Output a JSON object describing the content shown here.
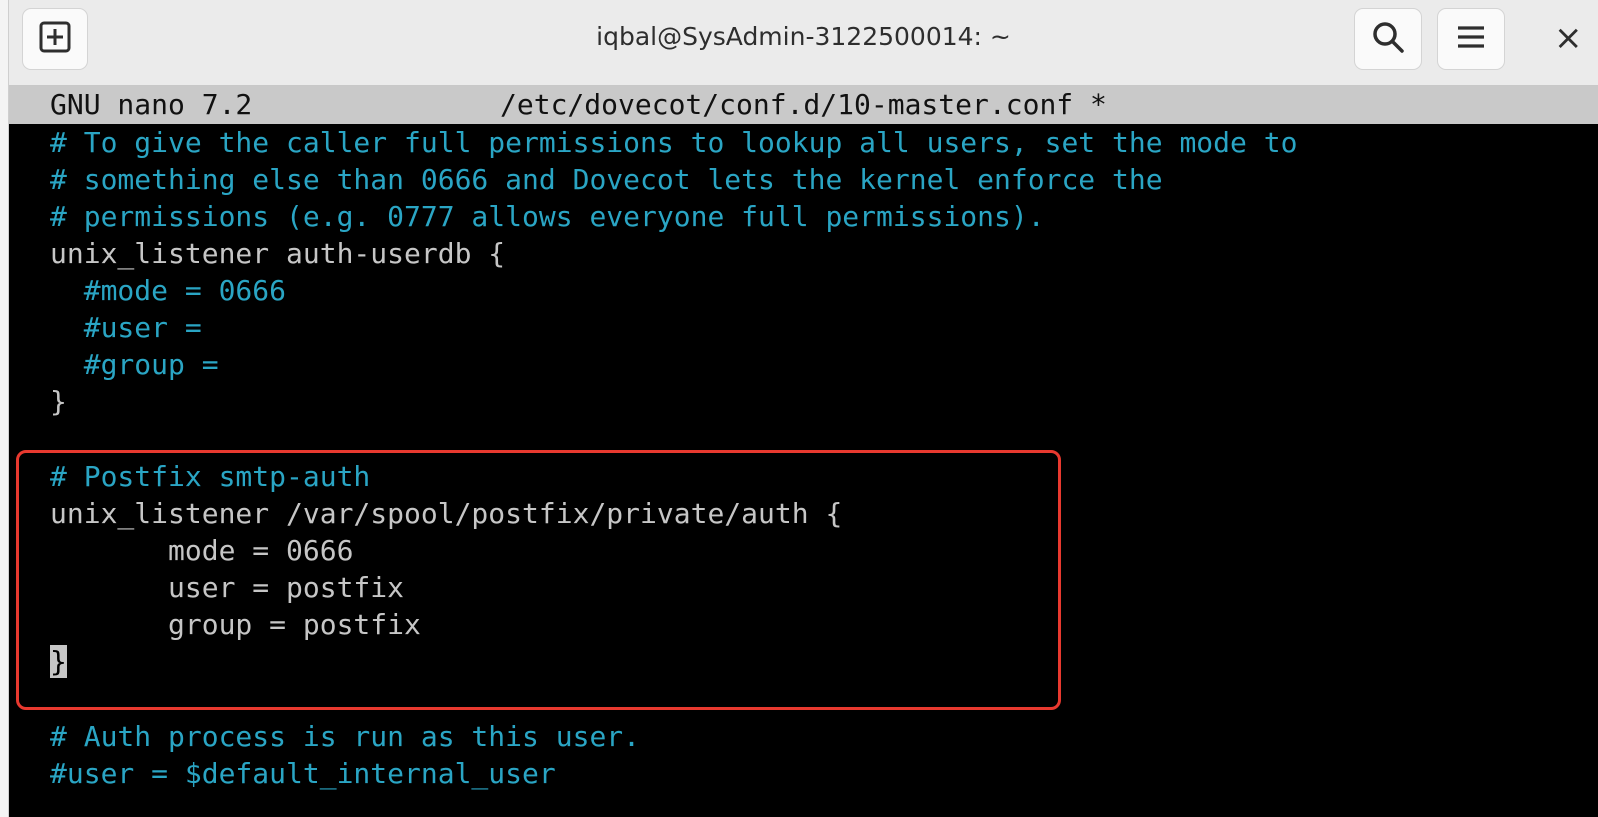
{
  "window": {
    "title": "iqbal@SysAdmin-3122500014: ~",
    "new_tab_icon": "plus-square-icon",
    "search_icon": "search-icon",
    "menu_icon": "hamburger-menu-icon",
    "close_label": "×"
  },
  "nano": {
    "version": "GNU nano 7.2",
    "filename": "/etc/dovecot/conf.d/10-master.conf *"
  },
  "lines": [
    {
      "text": "# To give the caller full permissions to lookup all users, set the mode to",
      "kind": "comment"
    },
    {
      "text": "# something else than 0666 and Dovecot lets the kernel enforce the",
      "kind": "comment"
    },
    {
      "text": "# permissions (e.g. 0777 allows everyone full permissions).",
      "kind": "comment"
    },
    {
      "text": "unix_listener auth-userdb {",
      "kind": "code"
    },
    {
      "text": "  #mode = 0666",
      "kind": "comment"
    },
    {
      "text": "  #user =",
      "kind": "comment"
    },
    {
      "text": "  #group =",
      "kind": "comment"
    },
    {
      "text": "}",
      "kind": "code"
    },
    {
      "text": "",
      "kind": "code"
    },
    {
      "text": "# Postfix smtp-auth",
      "kind": "comment"
    },
    {
      "text": "unix_listener /var/spool/postfix/private/auth {",
      "kind": "code"
    },
    {
      "text": "       mode = 0666",
      "kind": "code"
    },
    {
      "text": "       user = postfix",
      "kind": "code"
    },
    {
      "text": "       group = postfix",
      "kind": "code"
    },
    {
      "text": "}",
      "kind": "cursor"
    },
    {
      "text": "",
      "kind": "code"
    },
    {
      "text": "# Auth process is run as this user.",
      "kind": "comment"
    },
    {
      "text": "#user = $default_internal_user",
      "kind": "comment"
    }
  ],
  "colors": {
    "comment": "#2aa5c4",
    "code": "#c6c6c6",
    "highlight_border": "#e8392f",
    "header_bg": "#c9c9c9",
    "terminal_bg": "#000000"
  }
}
